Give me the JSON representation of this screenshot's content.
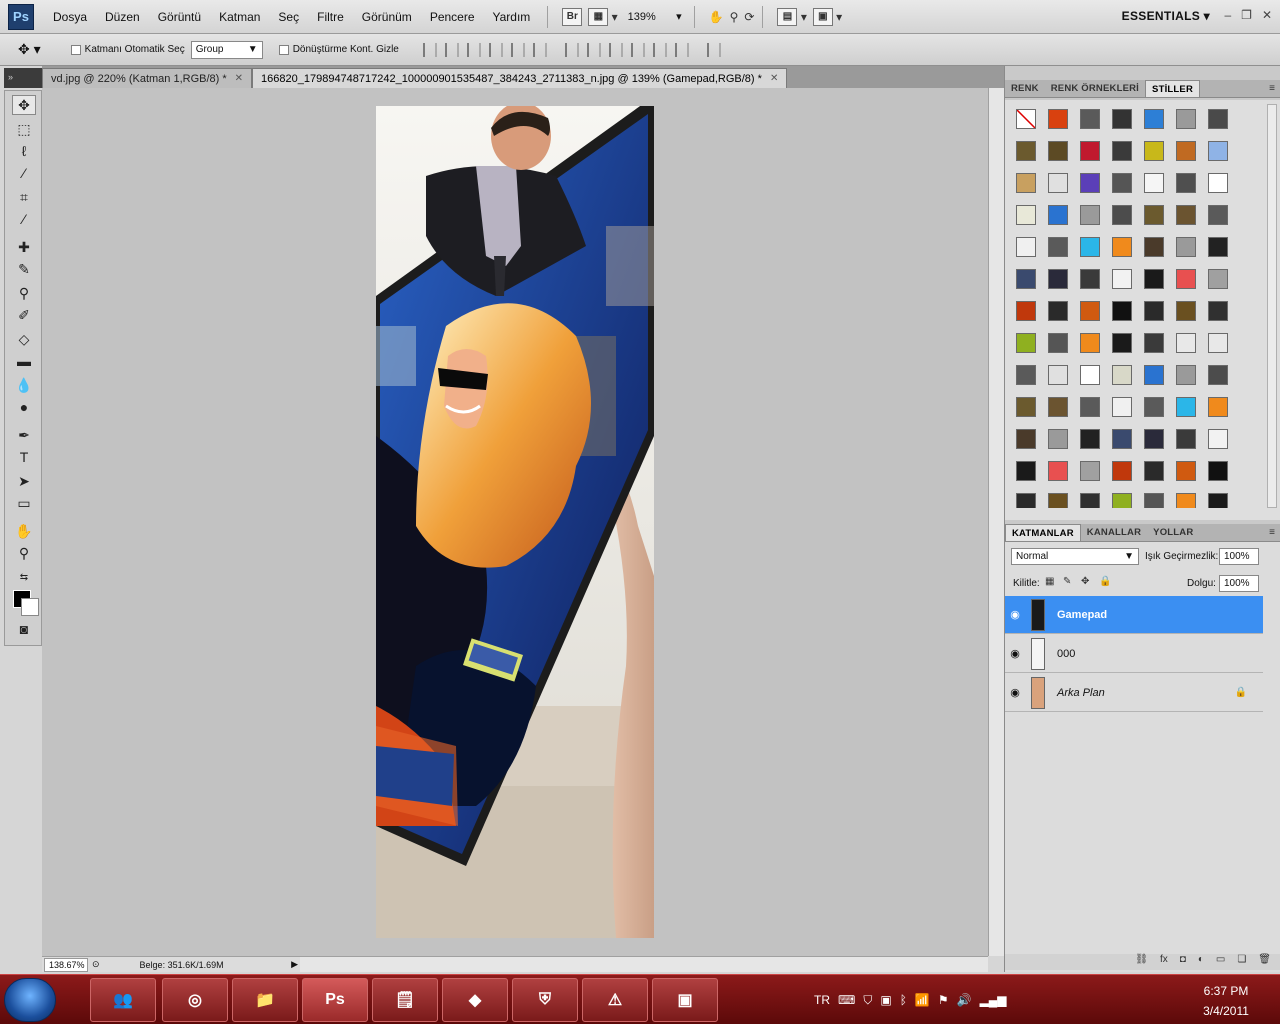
{
  "app": {
    "logo_text": "Ps"
  },
  "menu": [
    "Dosya",
    "Düzen",
    "Görüntü",
    "Katman",
    "Seç",
    "Filtre",
    "Görünüm",
    "Pencere",
    "Yardım"
  ],
  "menubar_tools": {
    "bridge_label": "Br",
    "zoom_value": "139%",
    "workspace": "ESSENTIALS"
  },
  "options_bar": {
    "auto_select_label": "Katmanı Otomatik Seç",
    "auto_select_target": "Group",
    "transform_label": "Dönüştürme Kont. Gizle"
  },
  "document_tabs": [
    {
      "label": "vd.jpg @ 220% (Katman 1,RGB/8) *",
      "active": false
    },
    {
      "label": "166820_179894748717242_100000901535487_384243_2711383_n.jpg @ 139% (Gamepad,RGB/8) *",
      "active": true
    }
  ],
  "status_bar": {
    "zoom": "138.67%",
    "doc_info": "Belge: 351.6K/1.69M"
  },
  "style_panel": {
    "tabs": [
      "RENK",
      "RENK ÖRNEKLERİ",
      "STİLLER"
    ],
    "active_tab": "STİLLER",
    "swatch_colors": [
      "#ffffff",
      "#d9410f",
      "#5a5a5a",
      "#333333",
      "#2d7fd6",
      "#9a9a9a",
      "#4a4a4a",
      "#6b5a2e",
      "#5c4a24",
      "#c0192e",
      "#3a3a3a",
      "#c8b81a",
      "#c06a22",
      "#8fb3e6",
      "#c8a060",
      "#e0e0e0",
      "#5b3fb8",
      "#555555",
      "#f5f5f5",
      "#4f4f4f",
      "#ffffff",
      "#e8e8d8",
      "#2a73d0",
      "#9a9a9a",
      "#4c4c4c",
      "#6b5a2e",
      "#6b5430",
      "#5a5a5a",
      "#f0f0f0",
      "#5a5a5a",
      "#2bb6e8",
      "#f08a1c",
      "#4a3a2a",
      "#9a9a9a",
      "#222222",
      "#3a4a6e",
      "#2a2a3a",
      "#3a3a3a",
      "#f2f2f2",
      "#1a1a1a",
      "#e85050",
      "#a0a0a0",
      "#c0380c",
      "#2a2a2a",
      "#d05a10",
      "#111111",
      "#2a2a2a",
      "#6a5020",
      "#303030",
      "#8fb020",
      "#555555",
      "#f08a1c",
      "#1a1a1a",
      "#3a3a3a",
      "#e8e8e8",
      "#e8e8e8",
      "#5a5a5a",
      "#e0e0e0",
      "#ffffff",
      "#d8d8c8",
      "#2a73d0",
      "#9a9a9a",
      "#4c4c4c",
      "#6b5a2e",
      "#6b5430",
      "#5a5a5a",
      "#f0f0f0",
      "#5a5a5a",
      "#2bb6e8",
      "#f08a1c",
      "#4a3a2a",
      "#9a9a9a",
      "#222222",
      "#3a4a6e",
      "#2a2a3a",
      "#3a3a3a",
      "#f2f2f2",
      "#1a1a1a",
      "#e85050",
      "#a0a0a0",
      "#c0380c",
      "#2a2a2a",
      "#d05a10",
      "#111111",
      "#2a2a2a",
      "#6a5020",
      "#303030",
      "#8fb020",
      "#555555",
      "#f08a1c",
      "#1a1a1a"
    ]
  },
  "layers_panel": {
    "tabs": [
      "KATMANLAR",
      "KANALLAR",
      "YOLLAR"
    ],
    "active_tab": "KATMANLAR",
    "blend_mode": "Normal",
    "opacity_label": "Işık Geçirmezlik:",
    "opacity_value": "100%",
    "lock_label": "Kilitle:",
    "fill_label": "Dolgu:",
    "fill_value": "100%",
    "layers": [
      {
        "name": "Gamepad",
        "selected": true,
        "italic": false,
        "locked": false
      },
      {
        "name": "000",
        "selected": false,
        "italic": false,
        "locked": false
      },
      {
        "name": "Arka Plan",
        "selected": false,
        "italic": true,
        "locked": true
      }
    ]
  },
  "taskbar": {
    "language": "TR",
    "time": "6:37 PM",
    "date": "3/4/2011",
    "photoshop_label": "Ps"
  }
}
